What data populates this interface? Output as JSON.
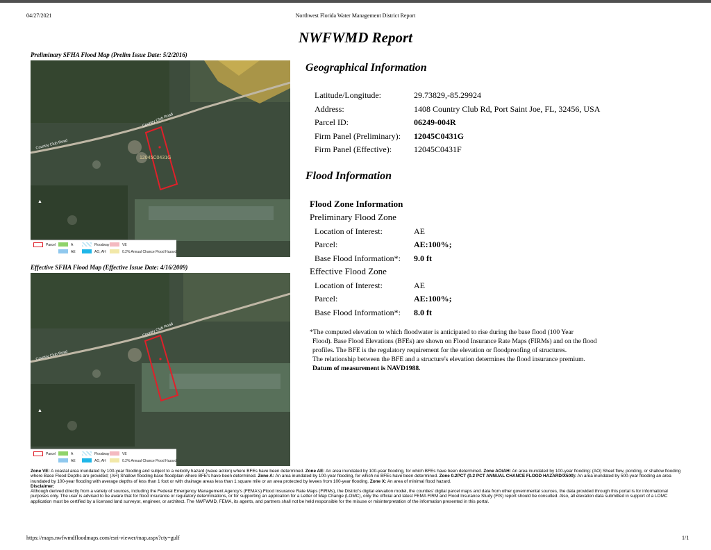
{
  "header": {
    "date": "04/27/2021",
    "report_org": "Northwest Florida Water Management District Report",
    "title": "NWFWMD Report"
  },
  "maps": {
    "preliminary": {
      "caption": "Preliminary SFHA Flood Map (Prelim Issue Date: 5/2/2016)",
      "road_label": "Country Club Road",
      "zone_label": "12045C0431G"
    },
    "effective": {
      "caption": "Effective SFHA Flood Map (Effective Issue Date: 4/16/2009)",
      "road_label": "Country Club Road"
    },
    "legend": {
      "parcel": "Parcel",
      "a": "A",
      "floodway": "Floodway",
      "ve": "VE",
      "ae": "AE",
      "ao_ah": "AO, AH",
      "annual_chance": "0.2% Annual Chance Flood Hazard",
      "colors": {
        "parcel": "#e0202a",
        "a": "#8fd36a",
        "floodway": "#bfe6f5",
        "ve": "#f4b9c0",
        "ae": "#8fc8ee",
        "ao_ah": "#1fb6e8",
        "annual_chance": "#f2e8a8"
      }
    }
  },
  "geo": {
    "heading": "Geographical Information",
    "rows": [
      {
        "label": "Latitude/Longitude:",
        "value": "29.73829,-85.29924"
      },
      {
        "label": "Address:",
        "value": "1408 Country Club Rd, Port Saint Joe, FL, 32456, USA"
      },
      {
        "label": "Parcel ID:",
        "value": "06249-004R"
      },
      {
        "label": "Firm Panel (Preliminary):",
        "value": "12045C0431G"
      },
      {
        "label": "Firm Panel (Effective):",
        "value": "12045C0431F"
      }
    ]
  },
  "flood": {
    "heading": "Flood Information",
    "zone_info_heading": "Flood Zone Information",
    "preliminary": {
      "heading": "Preliminary Flood Zone",
      "rows": [
        {
          "label": "Location of Interest:",
          "value": "AE"
        },
        {
          "label": "Parcel:",
          "value": "AE:100%;"
        },
        {
          "label": "Base Flood Information*:",
          "value": "9.0 ft"
        }
      ]
    },
    "effective": {
      "heading": "Effective Flood Zone",
      "rows": [
        {
          "label": "Location of Interest:",
          "value": "AE"
        },
        {
          "label": "Parcel:",
          "value": "AE:100%;"
        },
        {
          "label": "Base Flood Information*:",
          "value": "8.0 ft"
        }
      ]
    },
    "note": {
      "line1": "*The computed elevation to which floodwater is anticipated to rise during the base flood (100 Year",
      "line2": "Flood). Base Flood Elevations (BFEs) are shown on Flood Insurance Rate Maps (FIRMs) and on the flood",
      "line3": "profiles. The BFE is the regulatory requirement for the elevation or floodproofing of structures.",
      "line4": "The relationship between the BFE and a structure's elevation determines the flood insurance premium.",
      "datum": "Datum of measurement is NAVD1988."
    }
  },
  "legal": {
    "zone_ve_label": "Zone VE:",
    "zone_ve_text": " A coastal area inundated by 100-year flooding and subject to a velocity hazard (wave action) where BFEs have been determined. ",
    "zone_ae_label": "Zone AE:",
    "zone_ae_text": " An area inundated by 100-year flooding, for which BFEs have been determined. ",
    "zone_aoah_label": "Zone AO/AH:",
    "zone_aoah_text": " An area inundated by 100-year flooding: (AO) Sheet flow, ponding, or shallow flooding where Base Flood Depths are provided; (AH) Shallow flooding base floodplain where BFE's have been determined. ",
    "zone_a_label": "Zone A:",
    "zone_a_text": " An area inundated by 100-year flooding, for which no BFEs have been determined. ",
    "zone_02_label": "Zone 0.2PCT (0.2 PCT ANNUAL CHANCE FLOOD HAZARD/X500):",
    "zone_02_text": " An area inundated by 500-year flooding an area inundated by 100-year flooding with average depths of less than 1 foot or with drainage areas less than 1 square mile or an area protected by levees from 100-year flooding. ",
    "zone_x_label": "Zone X:",
    "zone_x_text": " An area of minimal flood hazard.",
    "disclaimer_label": "Disclaimer:",
    "disclaimer_text": "Although derived directly from a variety of sources, including the Federal Emergency Management Agency's (FEMA's) Flood Insurance Rate Maps (FIRMs), the District's digital elevation model, the counties' digital parcel maps and data from other governmental sources, the data provided through this portal is for informational purposes only. The user is advised to be aware that for flood insurance or regulatory determinations, or for supporting an application for a Letter of Map Change (LOMC), only the official and latest FEMA FIRM and Flood Insurance Study (FIS) report should be consulted. Also, all elevation data submitted in support of a LOMC application must be certified by a licensed land surveyor, engineer, or architect. The NWFWMD, FEMA, its agents, and partners shall not be held responsible for the misuse or misinterpretation of the information presented in this portal."
  },
  "footer": {
    "url": "https://maps.nwfwmdfloodmaps.com/esri-viewer/map.aspx?cty=gulf",
    "page": "1/1"
  }
}
